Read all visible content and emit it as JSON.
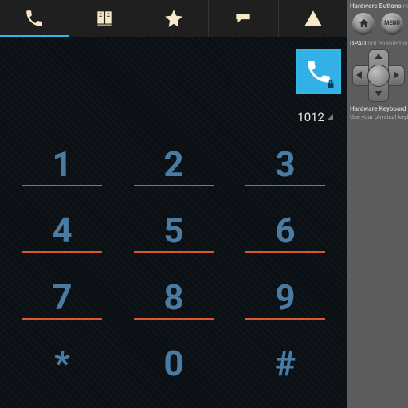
{
  "tabs": [
    {
      "name": "phone",
      "icon": "phone"
    },
    {
      "name": "contacts",
      "icon": "book"
    },
    {
      "name": "favorites",
      "icon": "star"
    },
    {
      "name": "messages",
      "icon": "speech"
    },
    {
      "name": "warnings",
      "icon": "warning"
    }
  ],
  "active_tab": 0,
  "display_value": "1012",
  "keypad": [
    {
      "label": "1",
      "underline": true
    },
    {
      "label": "2",
      "underline": true
    },
    {
      "label": "3",
      "underline": true
    },
    {
      "label": "4",
      "underline": true
    },
    {
      "label": "5",
      "underline": true
    },
    {
      "label": "6",
      "underline": true
    },
    {
      "label": "7",
      "underline": true
    },
    {
      "label": "8",
      "underline": true
    },
    {
      "label": "9",
      "underline": true
    },
    {
      "label": "*",
      "underline": false
    },
    {
      "label": "0",
      "underline": false
    },
    {
      "label": "#",
      "underline": false
    }
  ],
  "emulator_sidebar": {
    "hw_buttons_label": "Hardware Buttons",
    "hw_buttons_status": "not enabled",
    "home_button": "home",
    "menu_button_label": "MENU",
    "dpad_label": "DPAD",
    "dpad_status": "not enabled in AVD",
    "hw_keyboard_label": "Hardware Keyboard",
    "hw_keyboard_sub": "Use your physical keyboard"
  }
}
